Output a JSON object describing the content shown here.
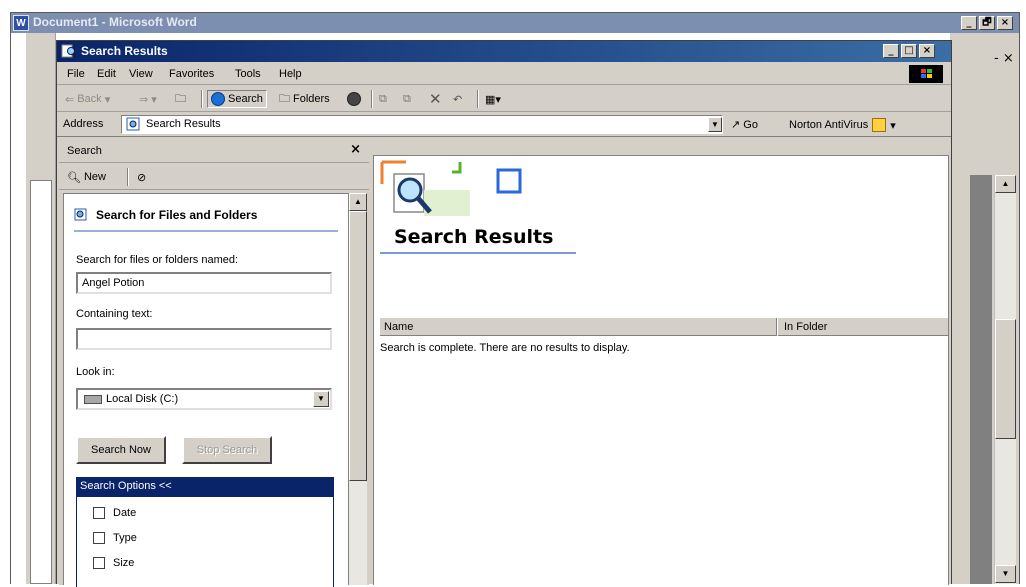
{
  "word": {
    "title": "Document1 - Microsoft Word",
    "close_glyph": "×",
    "minimize_glyph": "_",
    "restore_glyph": "🗗"
  },
  "window": {
    "title": "Search Results",
    "minimize_glyph": "_",
    "maximize_glyph": "□",
    "close_glyph": "×"
  },
  "menu": [
    "File",
    "Edit",
    "View",
    "Favorites",
    "Tools",
    "Help"
  ],
  "toolbar": {
    "back_label": "Back",
    "search_label": "Search",
    "folders_label": "Folders"
  },
  "address": {
    "label": "Address",
    "value": "Search Results",
    "go_label": "Go",
    "norton_label": "Norton AntiVirus"
  },
  "search_pane": {
    "title": "Search",
    "close_glyph": "×",
    "new_label": "New",
    "heading": "Search for Files and Folders",
    "named_label": "Search for files or folders named:",
    "named_value": "Angel Potion",
    "containing_label": "Containing text:",
    "containing_value": "",
    "lookin_label": "Look in:",
    "lookin_value": "Local Disk (C:)",
    "search_now_label": "Search Now",
    "stop_search_label": "Stop Search",
    "options_label": "Search Options <<",
    "options": [
      "Date",
      "Type",
      "Size"
    ]
  },
  "results": {
    "title": "Search Results",
    "col_name": "Name",
    "col_folder": "In Folder",
    "message": "Search is complete. There are no results to display."
  },
  "colors": {
    "titlebar_active": "#0a246a",
    "titlebar_gradient_end": "#3a6ea5",
    "face": "#d4d0c8"
  }
}
